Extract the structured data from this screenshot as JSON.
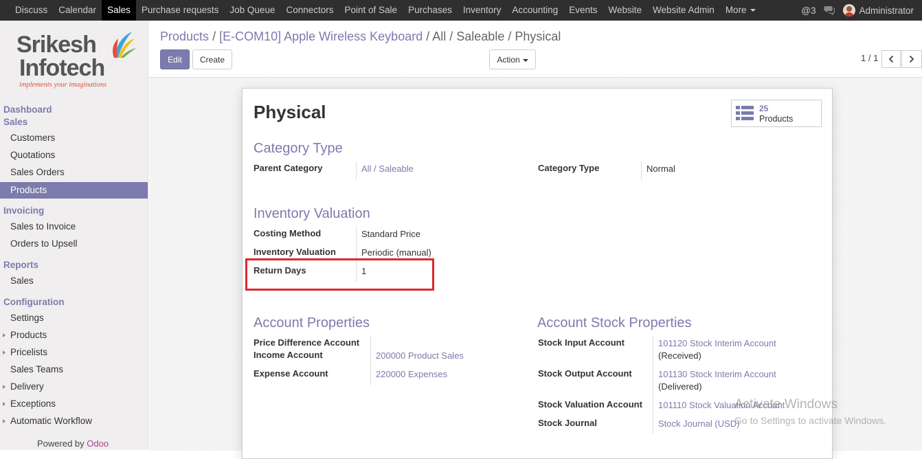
{
  "topbar": {
    "menu": [
      {
        "label": "Discuss"
      },
      {
        "label": "Calendar"
      },
      {
        "label": "Sales",
        "active": true
      },
      {
        "label": "Purchase requests"
      },
      {
        "label": "Job Queue"
      },
      {
        "label": "Connectors"
      },
      {
        "label": "Point of Sale"
      },
      {
        "label": "Purchases"
      },
      {
        "label": "Inventory"
      },
      {
        "label": "Accounting"
      },
      {
        "label": "Events"
      },
      {
        "label": "Website"
      },
      {
        "label": "Website Admin"
      },
      {
        "label": "More"
      }
    ],
    "mentions": "@3",
    "user": "Administrator"
  },
  "logo": {
    "line1": "Srikesh",
    "line2": "Infotech",
    "tagline": "implements your imaginations"
  },
  "sidebar": {
    "dashboard": "Dashboard",
    "sales_section": "Sales",
    "sales_items": [
      "Customers",
      "Quotations",
      "Sales Orders",
      "Products"
    ],
    "invoicing_section": "Invoicing",
    "invoicing_items": [
      "Sales to Invoice",
      "Orders to Upsell"
    ],
    "reports_section": "Reports",
    "reports_items": [
      "Sales"
    ],
    "config_section": "Configuration",
    "config_items": [
      "Settings",
      "Products",
      "Pricelists",
      "Sales Teams",
      "Delivery",
      "Exceptions",
      "Automatic Workflow"
    ],
    "powered_by": "Powered by",
    "powered_brand": "Odoo"
  },
  "breadcrumb": {
    "crumb1": "Products",
    "sep": "/",
    "crumb2": "[E-COM10] Apple Wireless Keyboard",
    "current": "All / Saleable / Physical"
  },
  "buttons": {
    "edit": "Edit",
    "create": "Create",
    "action": "Action"
  },
  "pager": {
    "text": "1 / 1"
  },
  "form": {
    "title": "Physical",
    "stat_count": "25",
    "stat_label": "Products",
    "category_type_heading": "Category Type",
    "parent_category_label": "Parent Category",
    "parent_category_value": "All / Saleable",
    "category_type_label": "Category Type",
    "category_type_value": "Normal",
    "inventory_valuation_heading": "Inventory Valuation",
    "costing_method_label": "Costing Method",
    "costing_method_value": "Standard Price",
    "inventory_valuation_label": "Inventory Valuation",
    "inventory_valuation_value": "Periodic (manual)",
    "return_days_label": "Return Days",
    "return_days_value": "1",
    "account_properties_heading": "Account Properties",
    "price_diff_label": "Price Difference Account",
    "income_label": "Income Account",
    "income_value": "200000 Product Sales",
    "expense_label": "Expense Account",
    "expense_value": "220000 Expenses",
    "account_stock_heading": "Account Stock Properties",
    "stock_input_label": "Stock Input Account",
    "stock_input_value1": "101120 Stock Interim Account",
    "stock_input_value2": "(Received)",
    "stock_output_label": "Stock Output Account",
    "stock_output_value1": "101130 Stock Interim Account",
    "stock_output_value2": "(Delivered)",
    "stock_valuation_label": "Stock Valuation Account",
    "stock_valuation_value": "101110 Stock Valuation Account",
    "stock_journal_label": "Stock Journal",
    "stock_journal_value": "Stock Journal (USD)"
  },
  "watermark": {
    "line1": "Activate Windows",
    "line2": "Go to Settings to activate Windows."
  },
  "colors": {
    "brand": "#7c7bad",
    "topbar": "#2f2f2f",
    "highlight": "#e0262e"
  }
}
